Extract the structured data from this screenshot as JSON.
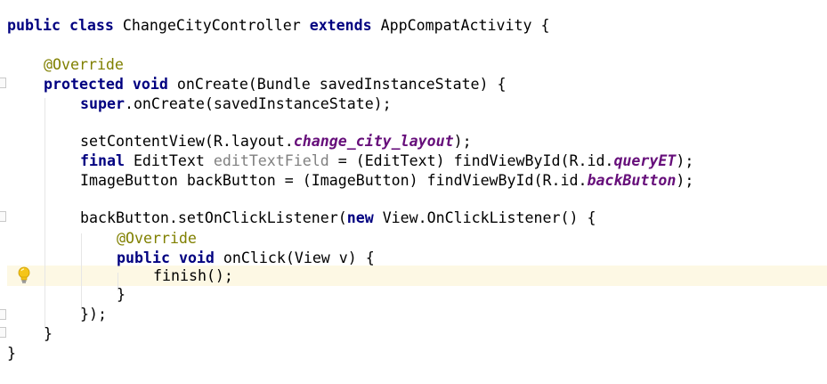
{
  "editor": {
    "lines": [
      {
        "id": "l1",
        "tokens": [
          "public",
          " ",
          "class",
          " ChangeCityController ",
          "extends",
          " AppCompatActivity {"
        ]
      },
      {
        "id": "l2",
        "tokens": [
          "@Override"
        ]
      },
      {
        "id": "l3",
        "tokens": [
          "protected",
          " ",
          "void",
          " onCreate(Bundle savedInstanceState) {"
        ]
      },
      {
        "id": "l4",
        "tokens": [
          "super",
          ".onCreate(savedInstanceState);"
        ]
      },
      {
        "id": "l5",
        "tokens": [
          "setContentView(R.layout.",
          "change_city_layout",
          ");"
        ]
      },
      {
        "id": "l6",
        "tokens": [
          "final",
          " EditText ",
          "editTextField",
          " = (EditText) findViewById(R.id.",
          "queryET",
          ");"
        ]
      },
      {
        "id": "l7",
        "tokens": [
          "ImageButton backButton = (ImageButton) findViewById(R.id.",
          "backButton",
          ");"
        ]
      },
      {
        "id": "l8",
        "tokens": [
          "backButton.setOnClickListener(",
          "new",
          " View.OnClickListener() {"
        ]
      },
      {
        "id": "l9",
        "tokens": [
          "@Override"
        ]
      },
      {
        "id": "l10",
        "tokens": [
          "public",
          " ",
          "void",
          " onClick(View v) {"
        ]
      },
      {
        "id": "l11",
        "tokens": [
          "finish();"
        ]
      },
      {
        "id": "l12",
        "tokens": [
          "}"
        ]
      },
      {
        "id": "l13",
        "tokens": [
          "});"
        ]
      },
      {
        "id": "l14",
        "tokens": [
          "}"
        ]
      },
      {
        "id": "l15",
        "tokens": [
          "}"
        ]
      }
    ]
  },
  "icons": {
    "intention_bulb": "lightbulb-icon"
  },
  "colors": {
    "keyword": "#000080",
    "annotation": "#808000",
    "static_field": "#660e7a",
    "unused_variable": "#808080",
    "caret_line": "#fdf8e4",
    "bulb": "#f5c518"
  }
}
